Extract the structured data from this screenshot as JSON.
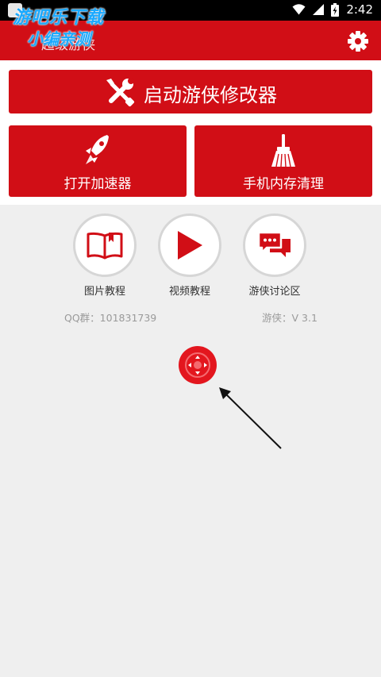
{
  "status_bar": {
    "time": "2:42"
  },
  "watermark": {
    "line1": "游吧乐下载",
    "line2": "小编亲测"
  },
  "header": {
    "title": "超级游侠"
  },
  "main_button": {
    "label": "启动游侠修改器",
    "icon": "tools-icon"
  },
  "half_buttons": [
    {
      "label": "打开加速器",
      "icon": "rocket-icon"
    },
    {
      "label": "手机内存清理",
      "icon": "broom-icon"
    }
  ],
  "tutorials": [
    {
      "label": "图片教程",
      "icon": "book-icon"
    },
    {
      "label": "视频教程",
      "icon": "play-icon"
    },
    {
      "label": "游侠讨论区",
      "icon": "chat-icon"
    }
  ],
  "info": {
    "qq_group": "QQ群：101831739",
    "version": "游侠：V 3.1"
  },
  "colors": {
    "brand_red": "#d10e16",
    "background": "#efefef"
  }
}
